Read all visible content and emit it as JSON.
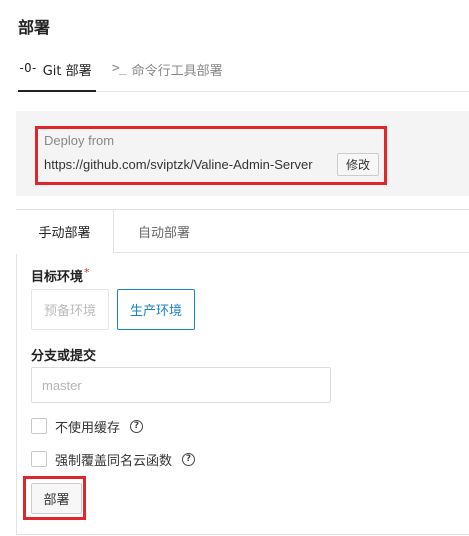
{
  "page": {
    "title": "部署"
  },
  "top_tabs": [
    {
      "icon": "git-commit-icon",
      "icon_glyph": "-O-",
      "label": "Git 部署",
      "active": true
    },
    {
      "icon": "terminal-icon",
      "icon_glyph": ">_",
      "label": "命令行工具部署",
      "active": false
    }
  ],
  "deploy_source": {
    "label": "Deploy from",
    "url": "https://github.com/sviptzk/Valine-Admin-Server",
    "edit_label": "修改"
  },
  "mode_tabs": [
    {
      "label": "手动部署",
      "active": true
    },
    {
      "label": "自动部署",
      "active": false
    }
  ],
  "form": {
    "env_label": "目标环境",
    "env_required": "*",
    "env_options": [
      {
        "label": "预备环境",
        "selected": false,
        "disabled": true
      },
      {
        "label": "生产环境",
        "selected": true,
        "disabled": false
      }
    ],
    "branch_label": "分支或提交",
    "branch_placeholder": "master",
    "branch_value": "",
    "options": [
      {
        "label": "不使用缓存",
        "checked": false,
        "help": "?"
      },
      {
        "label": "强制覆盖同名云函数",
        "checked": false,
        "help": "?"
      }
    ],
    "submit_label": "部署"
  },
  "colors": {
    "highlight": "#e0252b",
    "accent": "#1c84c6"
  }
}
